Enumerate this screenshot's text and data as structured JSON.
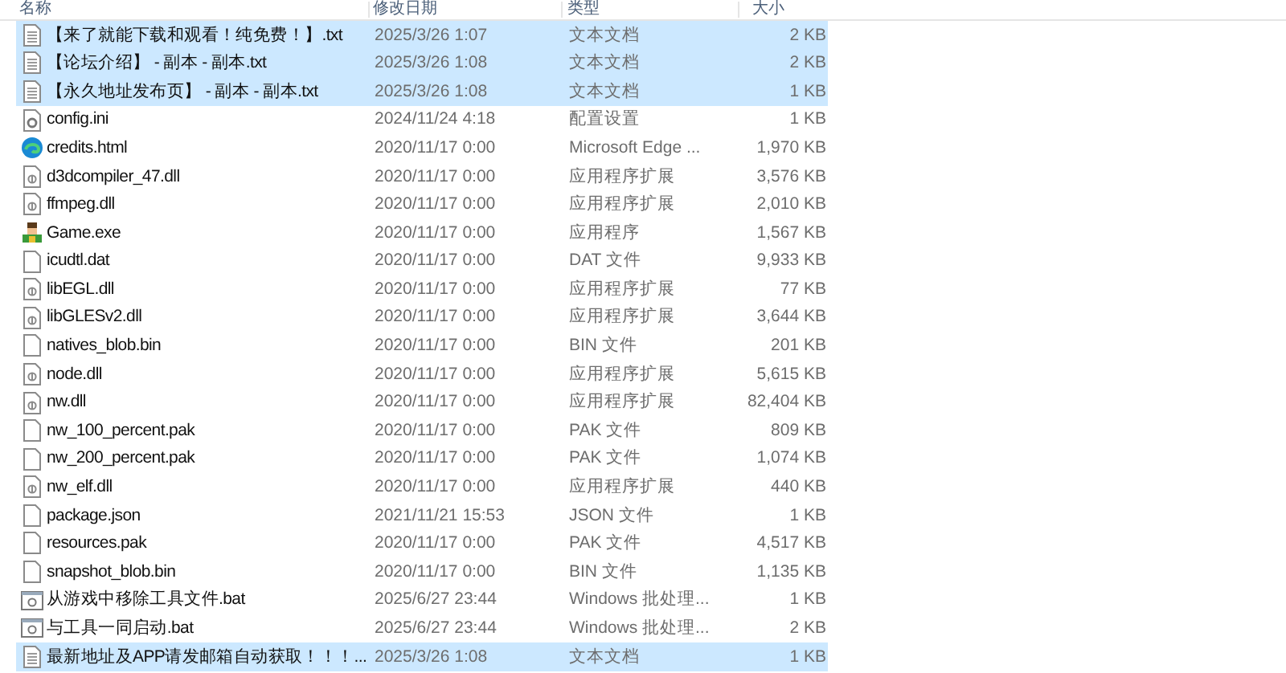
{
  "columns": [
    "名称",
    "修改日期",
    "类型",
    "大小"
  ],
  "files": [
    {
      "name": "【来了就能下载和观看！纯免费！】.txt",
      "date": "2025/3/26 1:07",
      "type": "文本文档",
      "size": "2 KB",
      "kind": "text",
      "selected": true
    },
    {
      "name": "【论坛介绍】 - 副本 - 副本.txt",
      "date": "2025/3/26 1:08",
      "type": "文本文档",
      "size": "2 KB",
      "kind": "text",
      "selected": true
    },
    {
      "name": "【永久地址发布页】 - 副本 - 副本.txt",
      "date": "2025/3/26 1:08",
      "type": "文本文档",
      "size": "1 KB",
      "kind": "text",
      "selected": true
    },
    {
      "name": "config.ini",
      "date": "2024/11/24 4:18",
      "type": "配置设置",
      "size": "1 KB",
      "kind": "settings",
      "selected": false
    },
    {
      "name": "credits.html",
      "date": "2020/11/17 0:00",
      "type": "Microsoft Edge ...",
      "size": "1,970 KB",
      "kind": "browser",
      "selected": false
    },
    {
      "name": "d3dcompiler_47.dll",
      "date": "2020/11/17 0:00",
      "type": "应用程序扩展",
      "size": "3,576 KB",
      "kind": "library",
      "selected": false
    },
    {
      "name": "ffmpeg.dll",
      "date": "2020/11/17 0:00",
      "type": "应用程序扩展",
      "size": "2,010 KB",
      "kind": "library",
      "selected": false
    },
    {
      "name": "Game.exe",
      "date": "2020/11/17 0:00",
      "type": "应用程序",
      "size": "1,567 KB",
      "kind": "app",
      "selected": false
    },
    {
      "name": "icudtl.dat",
      "date": "2020/11/17 0:00",
      "type": "DAT 文件",
      "size": "9,933 KB",
      "kind": "blank",
      "selected": false
    },
    {
      "name": "libEGL.dll",
      "date": "2020/11/17 0:00",
      "type": "应用程序扩展",
      "size": "77 KB",
      "kind": "library",
      "selected": false
    },
    {
      "name": "libGLESv2.dll",
      "date": "2020/11/17 0:00",
      "type": "应用程序扩展",
      "size": "3,644 KB",
      "kind": "library",
      "selected": false
    },
    {
      "name": "natives_blob.bin",
      "date": "2020/11/17 0:00",
      "type": "BIN 文件",
      "size": "201 KB",
      "kind": "blank",
      "selected": false
    },
    {
      "name": "node.dll",
      "date": "2020/11/17 0:00",
      "type": "应用程序扩展",
      "size": "5,615 KB",
      "kind": "library",
      "selected": false
    },
    {
      "name": "nw.dll",
      "date": "2020/11/17 0:00",
      "type": "应用程序扩展",
      "size": "82,404 KB",
      "kind": "library",
      "selected": false
    },
    {
      "name": "nw_100_percent.pak",
      "date": "2020/11/17 0:00",
      "type": "PAK 文件",
      "size": "809 KB",
      "kind": "blank",
      "selected": false
    },
    {
      "name": "nw_200_percent.pak",
      "date": "2020/11/17 0:00",
      "type": "PAK 文件",
      "size": "1,074 KB",
      "kind": "blank",
      "selected": false
    },
    {
      "name": "nw_elf.dll",
      "date": "2020/11/17 0:00",
      "type": "应用程序扩展",
      "size": "440 KB",
      "kind": "library",
      "selected": false
    },
    {
      "name": "package.json",
      "date": "2021/11/21 15:53",
      "type": "JSON 文件",
      "size": "1 KB",
      "kind": "blank",
      "selected": false
    },
    {
      "name": "resources.pak",
      "date": "2020/11/17 0:00",
      "type": "PAK 文件",
      "size": "4,517 KB",
      "kind": "blank",
      "selected": false
    },
    {
      "name": "snapshot_blob.bin",
      "date": "2020/11/17 0:00",
      "type": "BIN 文件",
      "size": "1,135 KB",
      "kind": "blank",
      "selected": false
    },
    {
      "name": "从游戏中移除工具文件.bat",
      "date": "2025/6/27 23:44",
      "type": "Windows 批处理...",
      "size": "1 KB",
      "kind": "batch",
      "selected": false
    },
    {
      "name": "与工具一同启动.bat",
      "date": "2025/6/27 23:44",
      "type": "Windows 批处理...",
      "size": "2 KB",
      "kind": "batch",
      "selected": false
    },
    {
      "name": "最新地址及APP请发邮箱自动获取！！！...",
      "date": "2025/3/26 1:08",
      "type": "文本文档",
      "size": "1 KB",
      "kind": "text",
      "selected": true
    }
  ]
}
